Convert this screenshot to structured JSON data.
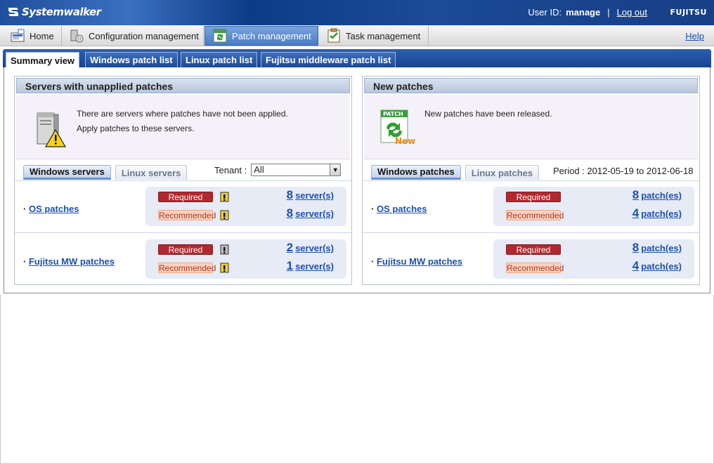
{
  "header": {
    "logo_text": "Systemwalker",
    "user_id_label": "User ID:",
    "user_id_value": "manage",
    "separator": "|",
    "logout_label": "Log out",
    "brand": "FUJITSU"
  },
  "nav": {
    "items": [
      {
        "label": "Home",
        "icon": "home-icon"
      },
      {
        "label": "Configuration management",
        "icon": "configuration-icon"
      },
      {
        "label": "Patch management",
        "icon": "patch-icon",
        "active": true
      },
      {
        "label": "Task management",
        "icon": "task-icon"
      }
    ],
    "help_label": "Help"
  },
  "subtabs": [
    {
      "label": "Summary view",
      "active": true
    },
    {
      "label": "Windows patch list"
    },
    {
      "label": "Linux patch list"
    },
    {
      "label": "Fujitsu middleware patch list"
    }
  ],
  "left_panel": {
    "title": "Servers with unapplied patches",
    "message_line1": "There are servers where patches have not been applied.",
    "message_line2": "Apply patches to these servers.",
    "tabs": [
      "Windows servers",
      "Linux servers"
    ],
    "tenant_label": "Tenant :",
    "tenant_value": "All",
    "rows": [
      {
        "label": "OS patches",
        "required": {
          "badge": "Required",
          "count": "8",
          "unit": "server(s)"
        },
        "recommended": {
          "badge": "Recommended",
          "count": "8",
          "unit": "server(s)"
        }
      },
      {
        "label": "Fujitsu MW patches",
        "required": {
          "badge": "Required",
          "count": "2",
          "unit": "server(s)"
        },
        "recommended": {
          "badge": "Recommended",
          "count": "1",
          "unit": "server(s)"
        }
      }
    ]
  },
  "right_panel": {
    "title": "New patches",
    "message_line1": "New patches have been released.",
    "icon_patch_text": "PATCH",
    "icon_new_text": "New",
    "tabs": [
      "Windows patches",
      "Linux patches"
    ],
    "period": "Period : 2012-05-19 to 2012-06-18",
    "rows": [
      {
        "label": "OS patches",
        "required": {
          "badge": "Required",
          "count": "8",
          "unit": "patch(es)"
        },
        "recommended": {
          "badge": "Recommended",
          "count": "4",
          "unit": "patch(es)"
        }
      },
      {
        "label": "Fujitsu MW patches",
        "required": {
          "badge": "Required",
          "count": "8",
          "unit": "patch(es)"
        },
        "recommended": {
          "badge": "Recommended",
          "count": "4",
          "unit": "patch(es)"
        }
      }
    ]
  },
  "colors": {
    "header_blue": "#173f86",
    "required_red": "#b2282e",
    "recommended_peach": "#fbd2bf",
    "link_blue": "#1d4fb0"
  }
}
